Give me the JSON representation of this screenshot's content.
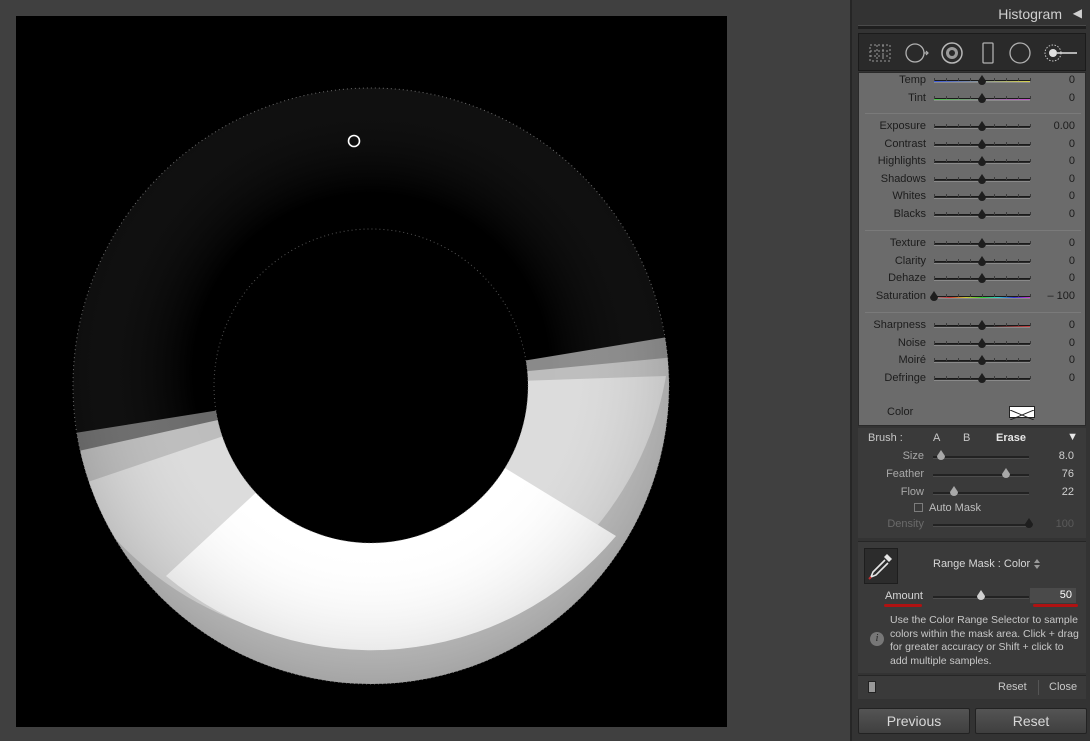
{
  "histogram": {
    "title": "Histogram",
    "toggle": "◀"
  },
  "toolbar": {
    "tools": [
      "crop-overlay-icon",
      "spot-removal-icon",
      "red-eye-icon",
      "graduated-filter-icon",
      "radial-filter-icon",
      "adjustment-brush-icon"
    ]
  },
  "adjust": {
    "groups": [
      [
        {
          "label": "Temp",
          "value": "0",
          "pos": 0.5,
          "track": "temp"
        },
        {
          "label": "Tint",
          "value": "0",
          "pos": 0.5,
          "track": "tint"
        }
      ],
      [
        {
          "label": "Exposure",
          "value": "0.00",
          "pos": 0.5
        },
        {
          "label": "Contrast",
          "value": "0",
          "pos": 0.5
        },
        {
          "label": "Highlights",
          "value": "0",
          "pos": 0.5
        },
        {
          "label": "Shadows",
          "value": "0",
          "pos": 0.5
        },
        {
          "label": "Whites",
          "value": "0",
          "pos": 0.5
        },
        {
          "label": "Blacks",
          "value": "0",
          "pos": 0.5
        }
      ],
      [
        {
          "label": "Texture",
          "value": "0",
          "pos": 0.5
        },
        {
          "label": "Clarity",
          "value": "0",
          "pos": 0.5
        },
        {
          "label": "Dehaze",
          "value": "0",
          "pos": 0.5
        },
        {
          "label": "Saturation",
          "value": "– 100",
          "pos": 0.0,
          "track": "sat"
        }
      ],
      [
        {
          "label": "Sharpness",
          "value": "0",
          "pos": 0.5,
          "track": "sharp"
        },
        {
          "label": "Noise",
          "value": "0",
          "pos": 0.5
        },
        {
          "label": "Moiré",
          "value": "0",
          "pos": 0.5
        },
        {
          "label": "Defringe",
          "value": "0",
          "pos": 0.5
        }
      ]
    ],
    "color_label": "Color"
  },
  "brush": {
    "label": "Brush :",
    "option_a": "A",
    "option_b": "B",
    "option_erase": "Erase",
    "collapse": "▼",
    "rows": [
      {
        "label": "Size",
        "value": "8.0",
        "pos": 0.08
      },
      {
        "label": "Feather",
        "value": "76",
        "pos": 0.76
      },
      {
        "label": "Flow",
        "value": "22",
        "pos": 0.22
      }
    ],
    "auto_mask": "Auto Mask",
    "density": {
      "label": "Density",
      "value": "100",
      "pos": 1.0
    }
  },
  "range_mask": {
    "title": "Range Mask : Color",
    "amount_label": "Amount",
    "amount_value": "50",
    "amount_pos": 0.5,
    "help": "Use the Color Range Selector to sample colors within the mask area. Click + drag for greater accuracy or Shift + click to add multiple samples.",
    "info": "i"
  },
  "footer": {
    "reset": "Reset",
    "close": "Close"
  },
  "buttons": {
    "previous": "Previous",
    "reset": "Reset"
  }
}
